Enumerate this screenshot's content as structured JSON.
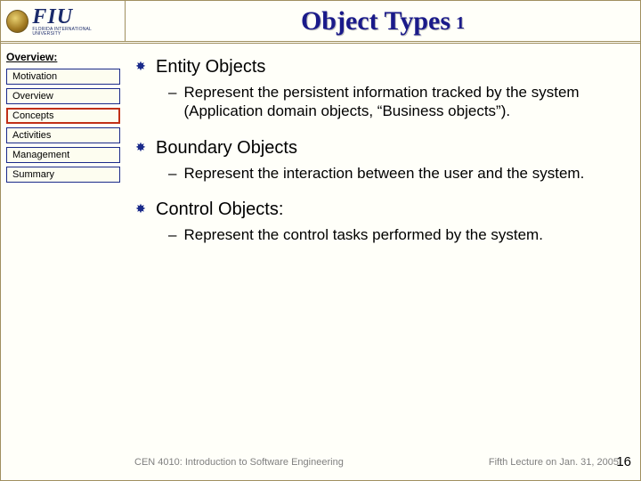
{
  "header": {
    "logo_main": "FIU",
    "logo_sub": "FLORIDA INTERNATIONAL UNIVERSITY",
    "title": "Object Types",
    "title_index": "1"
  },
  "sidebar": {
    "heading": "Overview:",
    "items": [
      {
        "label": "Motivation",
        "active": false
      },
      {
        "label": "Overview",
        "active": false
      },
      {
        "label": "Concepts",
        "active": true
      },
      {
        "label": "Activities",
        "active": false
      },
      {
        "label": "Management",
        "active": false
      },
      {
        "label": "Summary",
        "active": false
      }
    ]
  },
  "content": {
    "bullets": [
      {
        "text": "Entity Objects",
        "sub": "Represent the persistent information tracked by the system (Application domain objects, “Business objects”)."
      },
      {
        "text": "Boundary Objects",
        "sub": "Represent the interaction between the user and the system."
      },
      {
        "text": "Control Objects:",
        "sub": "Represent the control tasks performed by the system."
      }
    ]
  },
  "footer": {
    "left": "CEN 4010: Introduction to Software Engineering",
    "right": "Fifth Lecture on Jan. 31, 2005",
    "page": "16"
  }
}
